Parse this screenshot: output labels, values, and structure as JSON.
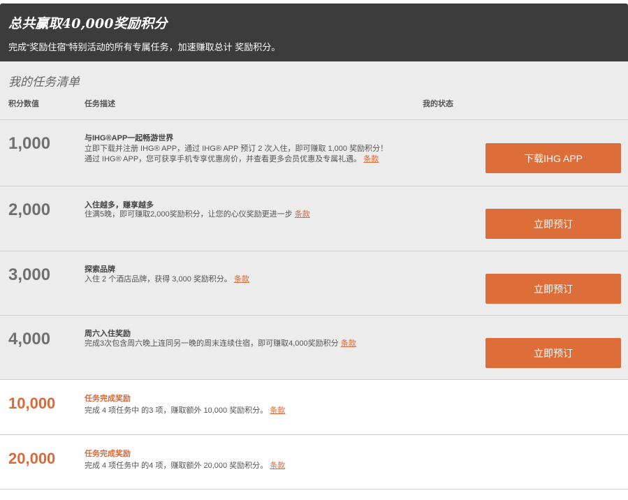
{
  "banner": {
    "title": "总共赢取40,000奖励积分",
    "subtitle": "完成“奖励住宿”特别活动的所有专属任务，加速赚取总计 奖励积分。"
  },
  "task_list": {
    "title": "我的任务清单",
    "headers": {
      "points": "积分数值",
      "description": "任务描述",
      "status": "我的状态"
    }
  },
  "tasks": [
    {
      "points": "1,000",
      "title": "与IHG®APP一起畅游世界",
      "line1": "立即下载并注册 IHG® APP，通过 IHG® APP 预订 2 次入住，即可赚取 1,000 奖励积分！",
      "line2": "通过 IHG® APP，您可获享手机专享优惠房价，并查看更多会员优惠及专属礼遇。",
      "terms": "条款",
      "button": "下载IHG APP"
    },
    {
      "points": "2,000",
      "title": "入住越多，赚享越多",
      "line1": "住满5晚，即可赚取2,000奖励积分，让您的心仪奖励更进一步",
      "terms": "条款",
      "button": "立即预订"
    },
    {
      "points": "3,000",
      "title": "探索品牌",
      "line1": "入住 2 个酒店品牌，获得 3,000 奖励积分。",
      "terms": "条款",
      "button": "立即预订"
    },
    {
      "points": "4,000",
      "title": "周六入住奖励",
      "line1": "完成3次包含周六晚上连同另一晚的周末连续住宿，即可赚取4,000奖励积分",
      "terms": "条款",
      "button": "立即预订"
    }
  ],
  "bonuses": [
    {
      "points": "10,000",
      "title": "任务完成奖励",
      "desc": "完成 4 项任务中 的3 项，赚取额外 10,000 奖励积分。",
      "terms": "条款"
    },
    {
      "points": "20,000",
      "title": "任务完成奖励",
      "desc": "完成 4 项任务中 的4 项，赚取额外 20,000 奖励积分。",
      "terms": "条款"
    }
  ],
  "colors": {
    "accent": "#dd6e3a",
    "banner_bg": "#3c3c3c",
    "list_bg": "#ececec"
  }
}
